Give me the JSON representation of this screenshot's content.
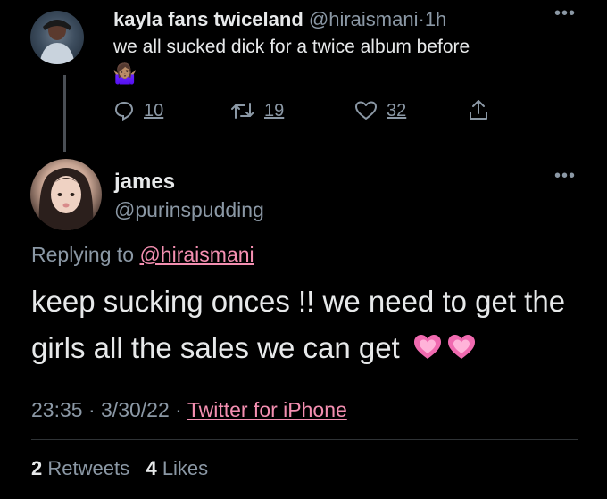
{
  "tweet1": {
    "display_name": "kayla fans twiceland",
    "handle": "@hiraismani",
    "separator": "·",
    "time": "1h",
    "text": "we all sucked dick for a twice album before",
    "emoji": "🤷🏽‍♀️",
    "reply_count": "10",
    "retweet_count": "19",
    "like_count": "32"
  },
  "tweet2": {
    "display_name": "james",
    "handle": "@purinspudding",
    "replying_prefix": "Replying to",
    "replying_to": "@hiraismani",
    "text": "keep sucking onces !! we need to get the girls all the sales we can get",
    "time": "23:35",
    "sep1": "·",
    "date": "3/30/22",
    "sep2": "·",
    "source": "Twitter for iPhone",
    "retweets_count": "2",
    "retweets_label": "Retweets",
    "likes_count": "4",
    "likes_label": "Likes"
  },
  "colors": {
    "background": "#000000",
    "text": "#e7e9ea",
    "muted": "#8b98a5",
    "link": "#f48fb1",
    "divider": "#2f3336"
  },
  "icons": {
    "more": "more-horizontal-icon",
    "reply": "speech-bubble-icon",
    "retweet": "retweet-arrows-icon",
    "like": "heart-outline-icon",
    "share": "share-upload-icon",
    "heart_emoji": "growing-heart-emoji"
  }
}
